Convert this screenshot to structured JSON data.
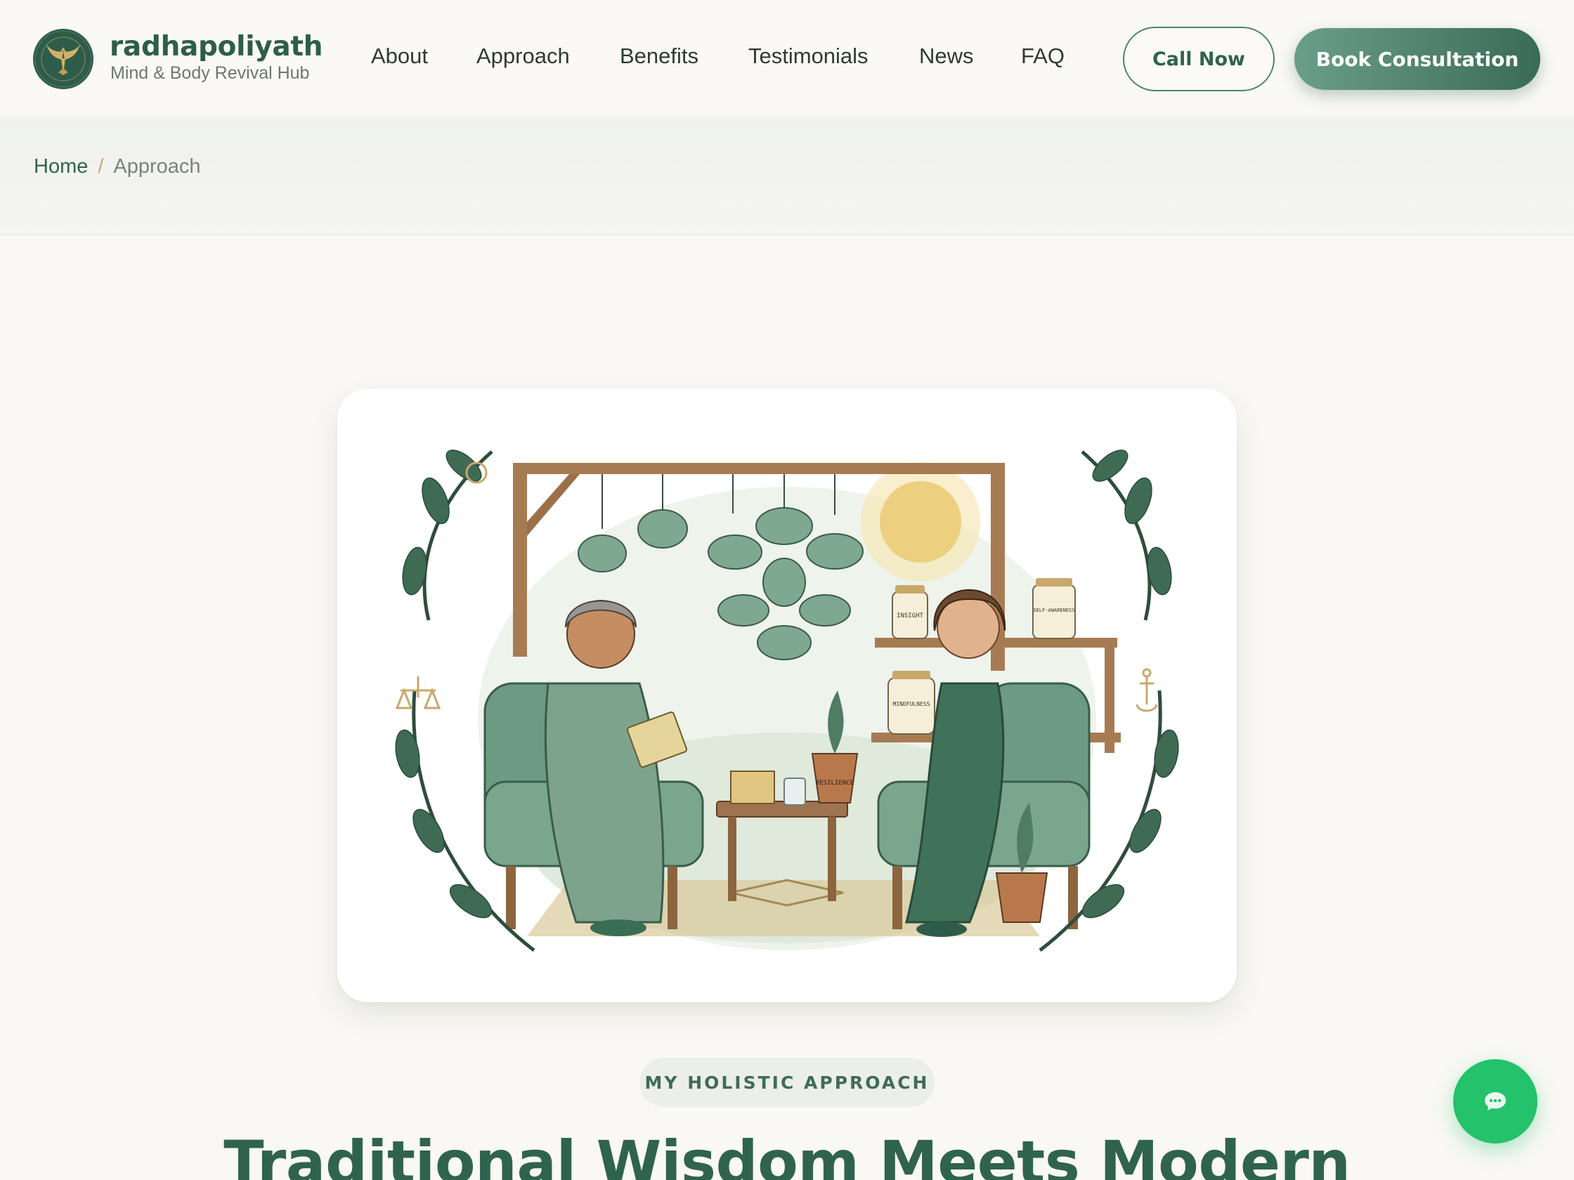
{
  "brand": {
    "name": "radhapoliyath",
    "tagline": "Mind & Body Revival Hub",
    "accent": "#2d5e4b",
    "gold": "#c9a86a"
  },
  "nav": {
    "items": [
      "About",
      "Approach",
      "Benefits",
      "Testimonials",
      "News",
      "FAQ"
    ],
    "call_label": "Call Now",
    "book_label": "Book Consultation"
  },
  "breadcrumb": {
    "home": "Home",
    "separator": "/",
    "current": "Approach"
  },
  "hero": {
    "image_labels": {
      "jar_1": "INSIGHT",
      "jar_2": "SELF-AWARENESS",
      "jar_3": "MINDFULNESS",
      "pot": "RESILIENCE"
    },
    "eyebrow": "MY HOLISTIC APPROACH",
    "heading": "Traditional Wisdom Meets Modern"
  },
  "chat": {
    "icon": "chat-bubble-icon",
    "color": "#23c26b"
  }
}
